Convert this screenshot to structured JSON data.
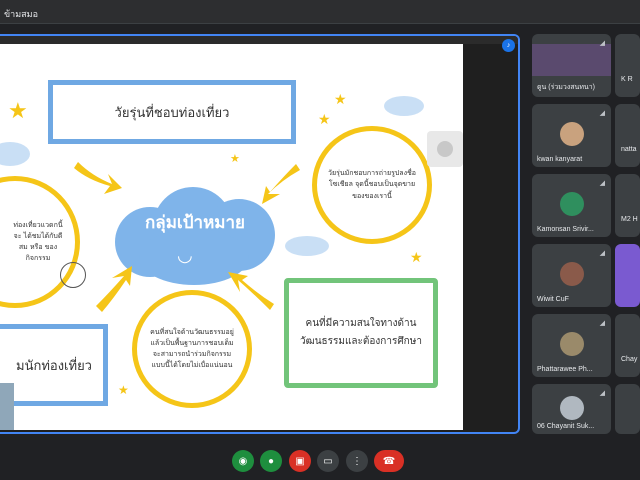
{
  "window": {
    "title": "ข้ามสมอ"
  },
  "slide": {
    "center_label": "กลุ่มเป้าหมาย",
    "boxes": [
      {
        "text": "วัยรุ่นที่ชอบท่องเที่ยว"
      },
      {
        "text": "คนที่มีความสนใจทางด้านวัฒนธรรมและต้องการศึกษา"
      },
      {
        "text": "มนักท่องเที่ยว"
      }
    ],
    "circles": [
      {
        "text": "วัยรุ่นมักชอบการถ่ายรูปลงชื่อโซเชียล จุดนี้ชอบเป็นจุดขายของของเรานี้"
      },
      {
        "text": "ท่องเที่ยวแวดกนี้จะ ได้ชมได้กับดีสม หรือ ของกิจกรรม"
      },
      {
        "text": "คนที่สนใจด้านวัฒนธรรมอยู่แล้วเป็นพื้นฐานการชอบเด็ม จะสามารถนำร่วมกิจกรรมแบบนี้ได้โดยไม่เบื่อแน่นอน"
      }
    ]
  },
  "participants": [
    {
      "name": "ดูน (ร่วมวงสนทนา)",
      "avatar_color": "#5a4a6e"
    },
    {
      "name": "K R",
      "avatar_color": "#3c4043"
    },
    {
      "name": "kwan kanyarat",
      "avatar_color": "#c9a27e"
    },
    {
      "name": "natta",
      "avatar_color": "#3c4043"
    },
    {
      "name": "Kamonsan Srivir...",
      "avatar_color": "#2f8f5e"
    },
    {
      "name": "M2 H",
      "avatar_color": "#3c4043"
    },
    {
      "name": "Wiwit CuF",
      "avatar_color": "#8a5a4a"
    },
    {
      "name": "Phattarawee Ph...",
      "avatar_color": "#9a8a6a"
    },
    {
      "name": "Chay",
      "avatar_color": "#3c4043"
    },
    {
      "name": "06 Chayanit Suk...",
      "avatar_color": "#b0b8c0"
    }
  ],
  "controls": {
    "camera_icon": "camera-icon",
    "mic_icon": "mic-icon",
    "present_icon": "present-icon",
    "more_icon": "more-icon",
    "hangup_icon": "hangup-icon"
  }
}
